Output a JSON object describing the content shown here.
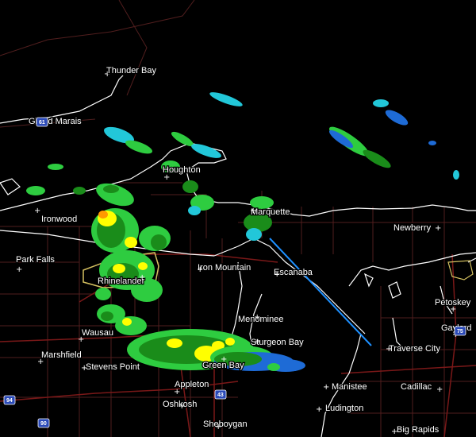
{
  "map": {
    "type": "weather radar reflectivity",
    "colors": {
      "background": "#000000",
      "land_border": "#ffffff",
      "county_lines": "#6b2a2a",
      "roads": "#7a1a1a",
      "radar_light": "#2ecc40",
      "radar_mid": "#1a8c1a",
      "radar_yellow": "#ffff00",
      "radar_orange": "#ff9900",
      "radar_blue": "#1e6bd6",
      "radar_cyan": "#22c7d9",
      "warning_box": "#d4c060",
      "front_line": "#1e90ff"
    }
  },
  "cities": [
    {
      "name": "Thunder Bay"
    },
    {
      "name": "Grand Marais"
    },
    {
      "name": "Houghton"
    },
    {
      "name": "Ironwood"
    },
    {
      "name": "Marquette"
    },
    {
      "name": "Newberry"
    },
    {
      "name": "Park Falls"
    },
    {
      "name": "Iron Mountain"
    },
    {
      "name": "Escanaba"
    },
    {
      "name": "Rhinelander"
    },
    {
      "name": "Petoskey"
    },
    {
      "name": "Gaylord"
    },
    {
      "name": "Menominee"
    },
    {
      "name": "Wausau"
    },
    {
      "name": "Sturgeon Bay"
    },
    {
      "name": "Traverse City"
    },
    {
      "name": "Marshfield"
    },
    {
      "name": "Green Bay"
    },
    {
      "name": "Stevens Point"
    },
    {
      "name": "Manistee"
    },
    {
      "name": "Cadillac"
    },
    {
      "name": "Appleton"
    },
    {
      "name": "Oshkosh"
    },
    {
      "name": "Ludington"
    },
    {
      "name": "Sheboygan"
    },
    {
      "name": "Big Rapids"
    }
  ],
  "shields": [
    {
      "label": "61",
      "icon": "interstate-shield-icon"
    },
    {
      "label": "75",
      "icon": "interstate-shield-icon"
    },
    {
      "label": "43",
      "icon": "interstate-shield-icon"
    },
    {
      "label": "94",
      "icon": "interstate-shield-icon"
    },
    {
      "label": "90",
      "icon": "interstate-shield-icon"
    }
  ]
}
